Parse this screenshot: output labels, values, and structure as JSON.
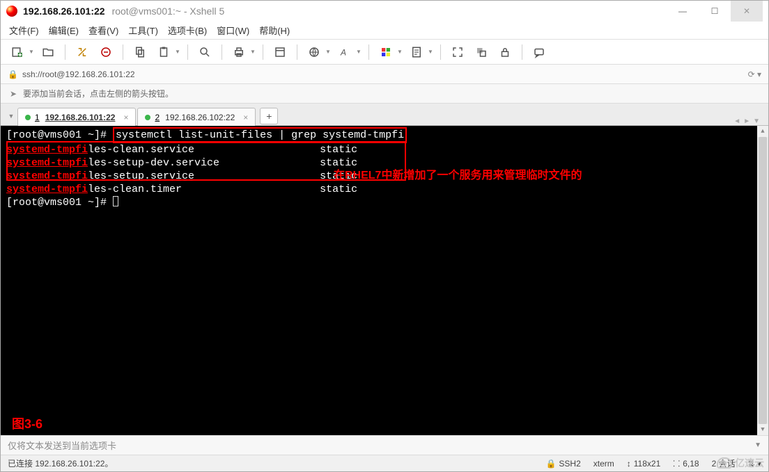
{
  "title": {
    "main": "192.168.26.101:22",
    "sub": "root@vms001:~ - Xshell 5"
  },
  "menu": [
    "文件(F)",
    "编辑(E)",
    "查看(V)",
    "工具(T)",
    "选项卡(B)",
    "窗口(W)",
    "帮助(H)"
  ],
  "address": "ssh://root@192.168.26.101:22",
  "hint": "要添加当前会话，点击左侧的箭头按钮。",
  "tabs": [
    {
      "num": "1",
      "label": "192.168.26.101:22",
      "active": true
    },
    {
      "num": "2",
      "label": "192.168.26.102:22",
      "active": false
    }
  ],
  "terminal": {
    "prompt1": "[root@vms001 ~]# ",
    "command": "systemctl list-unit-files | grep systemd-tmpfi",
    "rows": [
      {
        "red": "systemd-tmpfi",
        "white": "les-clean.service",
        "state": "static"
      },
      {
        "red": "systemd-tmpfi",
        "white": "les-setup-dev.service",
        "state": "static"
      },
      {
        "red": "systemd-tmpfi",
        "white": "les-setup.service",
        "state": "static"
      },
      {
        "red": "systemd-tmpfi",
        "white": "les-clean.timer",
        "state": "static"
      }
    ],
    "prompt2": "[root@vms001 ~]# ",
    "annotation": "在RHEL7中新增加了一个服务用来管理临时文件的",
    "figure": "图3-6"
  },
  "sendbar": "仅将文本发送到当前选项卡",
  "status": {
    "conn": "已连接 192.168.26.101:22。",
    "proto": "SSH2",
    "term": "xterm",
    "size": "118x21",
    "pos": "6,18",
    "sessions": "2 会话"
  },
  "watermark": "亿速云"
}
